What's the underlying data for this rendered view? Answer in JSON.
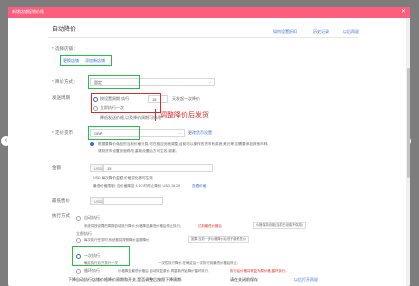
{
  "window": {
    "title": "新增店铺促销价格",
    "close_label": "✕"
  },
  "header": {
    "title": "自动降价",
    "help_label": "如何设置折扣",
    "history_label": "历史记录",
    "back_label": "以后再说"
  },
  "form": {
    "site_label": "* 选择店铺：",
    "site_value": "·",
    "site_links": [
      "更换店铺",
      "添加新店铺"
    ],
    "method_label": "* 降价方式：",
    "method_value": "固定",
    "cycle_label": "发送周期",
    "cycle_options": [
      "按设置周期 执行",
      "立即执行一次"
    ],
    "cycle_stepper": "15",
    "cycle_unit": "天发起一次降价",
    "cycle_note": "降低发送价格,以及降价周期可修改",
    "annotation": "调整降价后发货",
    "currency_label": "* 定价货币",
    "currency_value": "GBP",
    "currency_link": "更改货币设置",
    "currency_hint_1": "根据要降价商品的当前价格计算,可在相应页面调整,目前可以操作的货币有英镑,美元等,如需要添加其他币种,",
    "currency_hint_2": "请到货币设置页面修改,重新设置后方可生效,谢谢。",
    "amount_label": "金额",
    "amount_prefix": "USD",
    "amount_value": "15",
    "amount_note_1": "USD 每次降价金额,价格变化即时生效",
    "amount_note_2": "最低价格限制: 当价格降至 4.10 时停止降价 USD 28.29",
    "amount_note_link": "查看价格",
    "min_label": "最低售价",
    "min_prefix": "USD",
    "min_value": "",
    "exec_label": "执行方式",
    "exec_option_1": "自动执行",
    "exec_desc_1": "系统将按设置的周期自动执行降价,价格降至最低价格后停止执行。",
    "exec_desc_1_red": "达到最低价格后",
    "exec_desc_1_btn": "价格保持设置(当前已设置不保持)",
    "exec_option_2": "立即执行",
    "exec_desc_2": "每次执行任务时,系统都将按照降价金额降价",
    "exec_desc_2_btn": "如果:当前一步价格降价后低于最低售价",
    "exec_option_3": "一次执行",
    "exec_option_3_sub": "确定执行后只执行一次",
    "exec_desc_3": "一次性执行降价,在确定后一次执行到最低价格后停止。",
    "exec_option_4": "循环执行",
    "exec_desc_4": "价格降至最低价格后,自动恢复原价,再重新开始降价循环执行,",
    "exec_desc_4_red": "执行后价格将恢复为原价格,循环执行。",
    "footer_text": "下降自动执行店铺价格降价周期和开关,是否调整后按照下降周期:",
    "footer_link": "请在关闭前保存",
    "footer_btn": "以后打开再说"
  },
  "nav": {
    "prev": "‹",
    "next": "›"
  },
  "colors": {
    "titlebar": "#ff5d7d",
    "link": "#3a6fd8",
    "highlight": "#22c24a",
    "alert": "#e02828"
  }
}
